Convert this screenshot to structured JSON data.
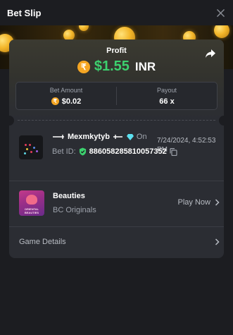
{
  "header": {
    "title": "Bet Slip"
  },
  "profit": {
    "label": "Profit",
    "amount": "$1.55",
    "currency": "INR",
    "coin_symbol": "₹"
  },
  "stats": {
    "bet_amount_label": "Bet Amount",
    "bet_amount_value": "$0.02",
    "payout_label": "Payout",
    "payout_value": "66 x"
  },
  "bet": {
    "username": "Mexmkytyb",
    "on_text": "On",
    "datetime": "7/24/2024, 4:52:53 PM",
    "bet_id_label": "Bet ID:",
    "bet_id": "886058285810057352"
  },
  "game": {
    "name": "Beauties",
    "provider": "BC Originals",
    "thumb_text": "ORIENTAL BEAUTIES",
    "play_label": "Play Now"
  },
  "details": {
    "label": "Game Details"
  },
  "colors": {
    "profit_green": "#3cd06e",
    "coin_gold": "#f5a623",
    "background": "#1c1d21",
    "card": "#2b2d33"
  },
  "icons": [
    "close-icon",
    "share-icon",
    "rupee-coin-icon",
    "shield-icon",
    "copy-icon",
    "chevron-right-icon",
    "diamond-icon"
  ]
}
